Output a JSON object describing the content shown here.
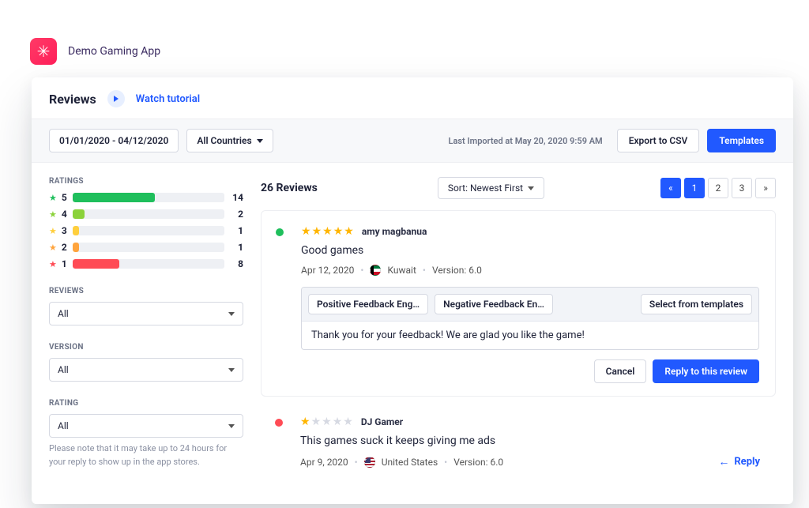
{
  "app": {
    "name": "Demo Gaming App"
  },
  "panel": {
    "title": "Reviews",
    "tutorial": "Watch tutorial"
  },
  "toolbar": {
    "date_range": "01/01/2020 - 04/12/2020",
    "country": "All Countries",
    "import_time": "Last Imported at May 20, 2020 9:59 AM",
    "export_label": "Export to CSV",
    "templates_label": "Templates"
  },
  "sidebar": {
    "ratings_label": "RATINGS",
    "ratings": [
      {
        "stars": "5",
        "color": "#1fbf5c",
        "pct": 54,
        "count": "14"
      },
      {
        "stars": "4",
        "color": "#8bd23a",
        "pct": 8,
        "count": "2"
      },
      {
        "stars": "3",
        "color": "#ffcf3d",
        "pct": 4,
        "count": "1"
      },
      {
        "stars": "2",
        "color": "#ffa43d",
        "pct": 4,
        "count": "1"
      },
      {
        "stars": "1",
        "color": "#ff4b55",
        "pct": 31,
        "count": "8"
      }
    ],
    "reviews_label": "REVIEWS",
    "reviews_value": "All",
    "version_label": "VERSION",
    "version_value": "All",
    "rating_label": "RATING",
    "rating_value": "All",
    "note": "Please note that it may take up to 24 hours for your reply to show up in the app stores."
  },
  "content": {
    "results": "26 Reviews",
    "sort": "Sort: Newest First",
    "pages": [
      "1",
      "2",
      "3"
    ]
  },
  "review1": {
    "author": "amy magbanua",
    "stars": 5,
    "text": "Good games",
    "date": "Apr 12, 2020",
    "country": "Kuwait",
    "version": "Version: 6.0",
    "templates": {
      "pos": "Positive Feedback Eng…",
      "neg": "Negative Feedback En…",
      "select": "Select from templates"
    },
    "reply_text": "Thank you for your feedback! We are glad you like the game!",
    "cancel": "Cancel",
    "submit": "Reply to this review"
  },
  "review2": {
    "author": "DJ Gamer",
    "stars": 1,
    "text": "This games suck it keeps giving me ads",
    "date": "Apr 9, 2020",
    "country": "United States",
    "version": "Version: 6.0",
    "reply_link": "Reply"
  }
}
